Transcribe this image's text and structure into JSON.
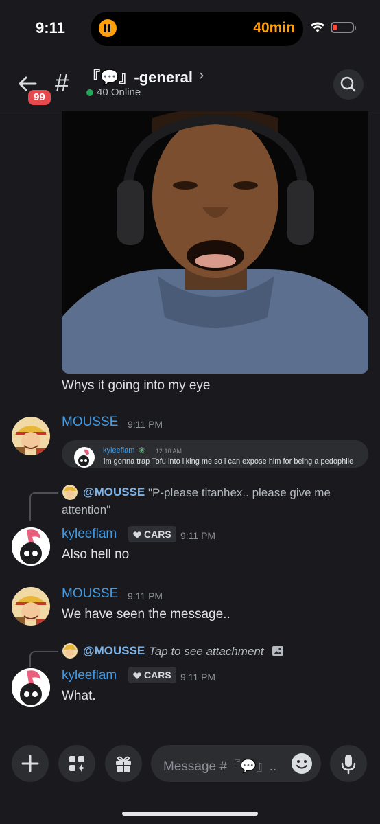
{
  "status_bar": {
    "time": "9:11",
    "timer": "40min"
  },
  "header": {
    "unread_count": "99",
    "channel_name": "『💬』-general",
    "online_count": "40 Online"
  },
  "messages": [
    {
      "text": "Whys it going into my eye"
    },
    {
      "author": "MOUSSE",
      "time": "9:11 PM",
      "embed": {
        "author": "kyleeflam",
        "time": "12:10 AM",
        "text": "im gonna trap Tofu into liking me so i can expose him for being a pedophile"
      }
    },
    {
      "reply": {
        "mention": "@MOUSSE",
        "text_line1": "\"P-please titanhex.. please give me",
        "text_line2": "attention\""
      },
      "author": "kyleeflam",
      "tag": "CARS",
      "time": "9:11 PM",
      "text": "Also hell no"
    },
    {
      "author": "MOUSSE",
      "time": "9:11 PM",
      "text": "We have seen the message.."
    },
    {
      "reply": {
        "mention": "@MOUSSE",
        "text": "Tap to see attachment"
      },
      "author": "kyleeflam",
      "tag": "CARS",
      "time": "9:11 PM",
      "text": "What."
    }
  ],
  "composer": {
    "placeholder": "Message #『💬』.."
  },
  "colors": {
    "background": "#1a1a1e",
    "username": "#3d9ce8",
    "badge": "#e5484d",
    "online": "#23a55a",
    "timer": "#ff9f0a"
  },
  "icons": [
    "pause-icon",
    "wifi-icon",
    "battery-icon",
    "back-arrow-icon",
    "hash-icon",
    "chevron-right-icon",
    "search-icon",
    "image-icon",
    "plus-icon",
    "apps-icon",
    "gift-icon",
    "emoji-icon",
    "microphone-icon"
  ]
}
